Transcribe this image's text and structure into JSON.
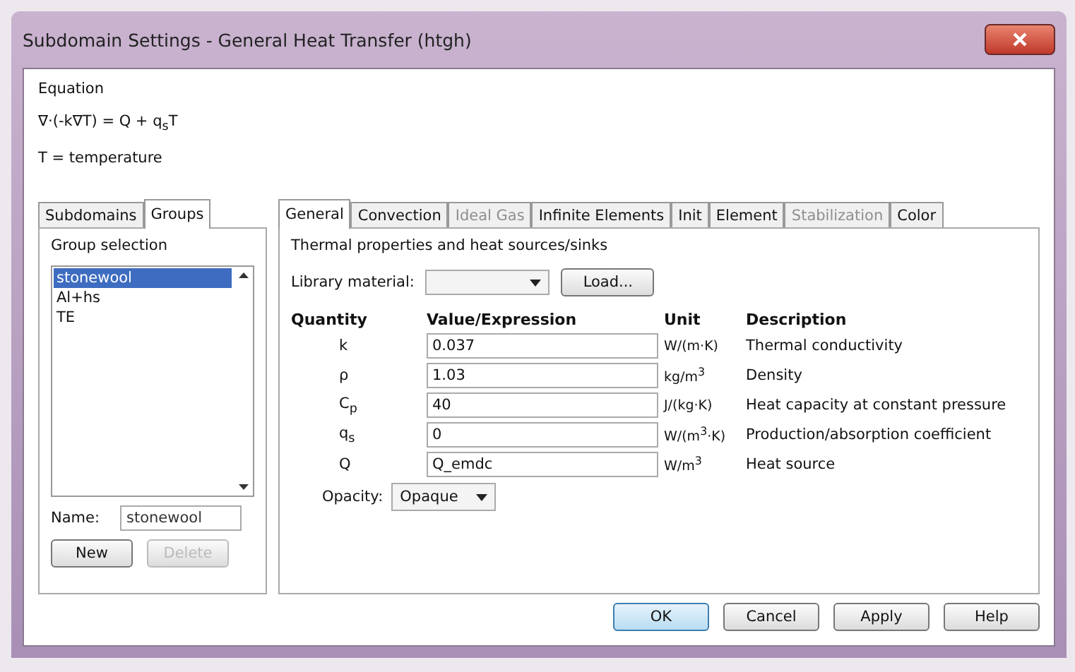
{
  "window": {
    "title": "Subdomain Settings - General Heat Transfer (htgh)"
  },
  "equation": {
    "heading": "Equation",
    "formula": "∇·(-k∇T) = Q + q$_{s}$T",
    "legend": "T = temperature"
  },
  "left_tabs": [
    {
      "label": "Subdomains",
      "selected": false
    },
    {
      "label": "Groups",
      "selected": true
    }
  ],
  "group_selection": {
    "heading": "Group selection",
    "items": [
      {
        "label": "stonewool",
        "selected": true
      },
      {
        "label": "Al+hs",
        "selected": false
      },
      {
        "label": "TE",
        "selected": false
      }
    ],
    "name_label": "Name:",
    "name_value": "stonewool",
    "buttons": [
      {
        "label": "New",
        "disabled": false
      },
      {
        "label": "Delete",
        "disabled": true
      }
    ]
  },
  "right_tabs": [
    {
      "label": "General",
      "selected": true,
      "disabled": false
    },
    {
      "label": "Convection",
      "selected": false,
      "disabled": false
    },
    {
      "label": "Ideal Gas",
      "selected": false,
      "disabled": true
    },
    {
      "label": "Infinite Elements",
      "selected": false,
      "disabled": false
    },
    {
      "label": "Init",
      "selected": false,
      "disabled": false
    },
    {
      "label": "Element",
      "selected": false,
      "disabled": false
    },
    {
      "label": "Stabilization",
      "selected": false,
      "disabled": true
    },
    {
      "label": "Color",
      "selected": false,
      "disabled": false
    }
  ],
  "general": {
    "heading": "Thermal properties and heat sources/sinks",
    "library_label": "Library material:",
    "load_button": "Load...",
    "columns": [
      "Quantity",
      "Value/Expression",
      "Unit",
      "Description"
    ],
    "rows": [
      {
        "quantity": "k",
        "value": "0.037",
        "unit": "W/(m·K)",
        "description": "Thermal conductivity"
      },
      {
        "quantity": "ρ",
        "value": "1.03",
        "unit": "kg/m$^{3}$",
        "description": "Density"
      },
      {
        "quantity": "C$_{p}$",
        "value": "40",
        "unit": "J/(kg·K)",
        "description": "Heat capacity at constant pressure"
      },
      {
        "quantity": "q$_{s}$",
        "value": "0",
        "unit": "W/(m$^{3}$·K)",
        "description": "Production/absorption coefficient"
      },
      {
        "quantity": "Q",
        "value": "Q_emdc",
        "unit": "W/m$^{3}$",
        "description": "Heat source"
      }
    ],
    "opacity_label": "Opacity:",
    "opacity_value": "Opaque"
  },
  "buttons": [
    {
      "label": "OK",
      "default": true
    },
    {
      "label": "Cancel",
      "default": false
    },
    {
      "label": "Apply",
      "default": false
    },
    {
      "label": "Help",
      "default": false
    }
  ]
}
